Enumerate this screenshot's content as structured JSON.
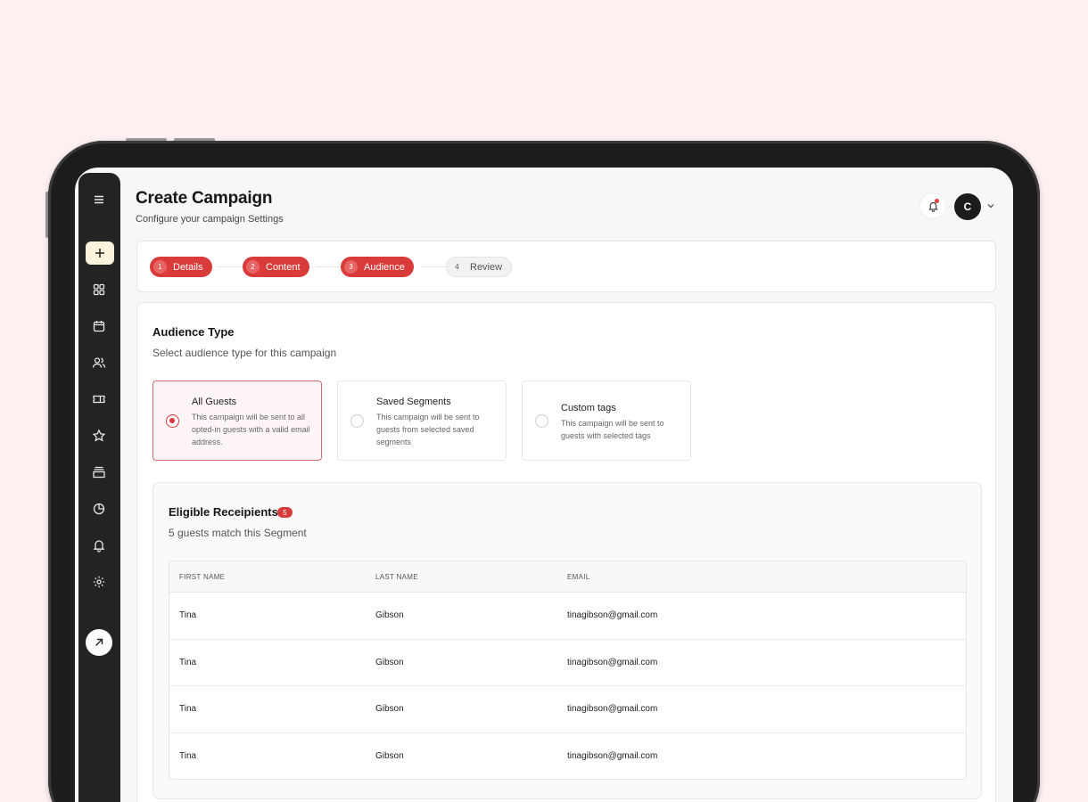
{
  "header": {
    "title": "Create Campaign",
    "subtitle": "Configure your campaign Settings",
    "avatar_initial": "C"
  },
  "stepper": {
    "steps": [
      {
        "num": "1",
        "label": "Details",
        "state": "done"
      },
      {
        "num": "2",
        "label": "Content",
        "state": "done"
      },
      {
        "num": "3",
        "label": "Audience",
        "state": "done"
      },
      {
        "num": "4",
        "label": "Review",
        "state": "todo"
      }
    ]
  },
  "audience": {
    "title": "Audience Type",
    "subtitle": "Select audience type for this campaign",
    "options": [
      {
        "title": "All Guests",
        "desc": "This campaign will be sent to all opted-in guests with a valid email address.",
        "selected": true
      },
      {
        "title": "Saved Segments",
        "desc": "This campaign will be sent to guests from selected saved segments",
        "selected": false
      },
      {
        "title": "Custom tags",
        "desc": "This campaign will be sent to guests with selected tags",
        "selected": false
      }
    ]
  },
  "recipients": {
    "title": "Eligible Receipients",
    "count": "5",
    "subtitle": "5 guests match this Segment",
    "columns": [
      "FIRST NAME",
      "LAST NAME",
      "EMAIL"
    ],
    "rows": [
      [
        "Tina",
        "Gibson",
        "tinagibson@gmail.com"
      ],
      [
        "Tina",
        "Gibson",
        "tinagibson@gmail.com"
      ],
      [
        "Tina",
        "Gibson",
        "tinagibson@gmail.com"
      ],
      [
        "Tina",
        "Gibson",
        "tinagibson@gmail.com"
      ]
    ]
  },
  "sidebar": {
    "icons": [
      "menu-icon",
      "plus-icon",
      "grid-icon",
      "calendar-icon",
      "users-icon",
      "ticket-icon",
      "star-icon",
      "inbox-icon",
      "pie-chart-icon",
      "bell-icon",
      "gear-icon",
      "external-link-icon"
    ]
  },
  "colors": {
    "accent": "#d93a3a",
    "background": "#fdf0f0",
    "sidebar": "#232323"
  }
}
